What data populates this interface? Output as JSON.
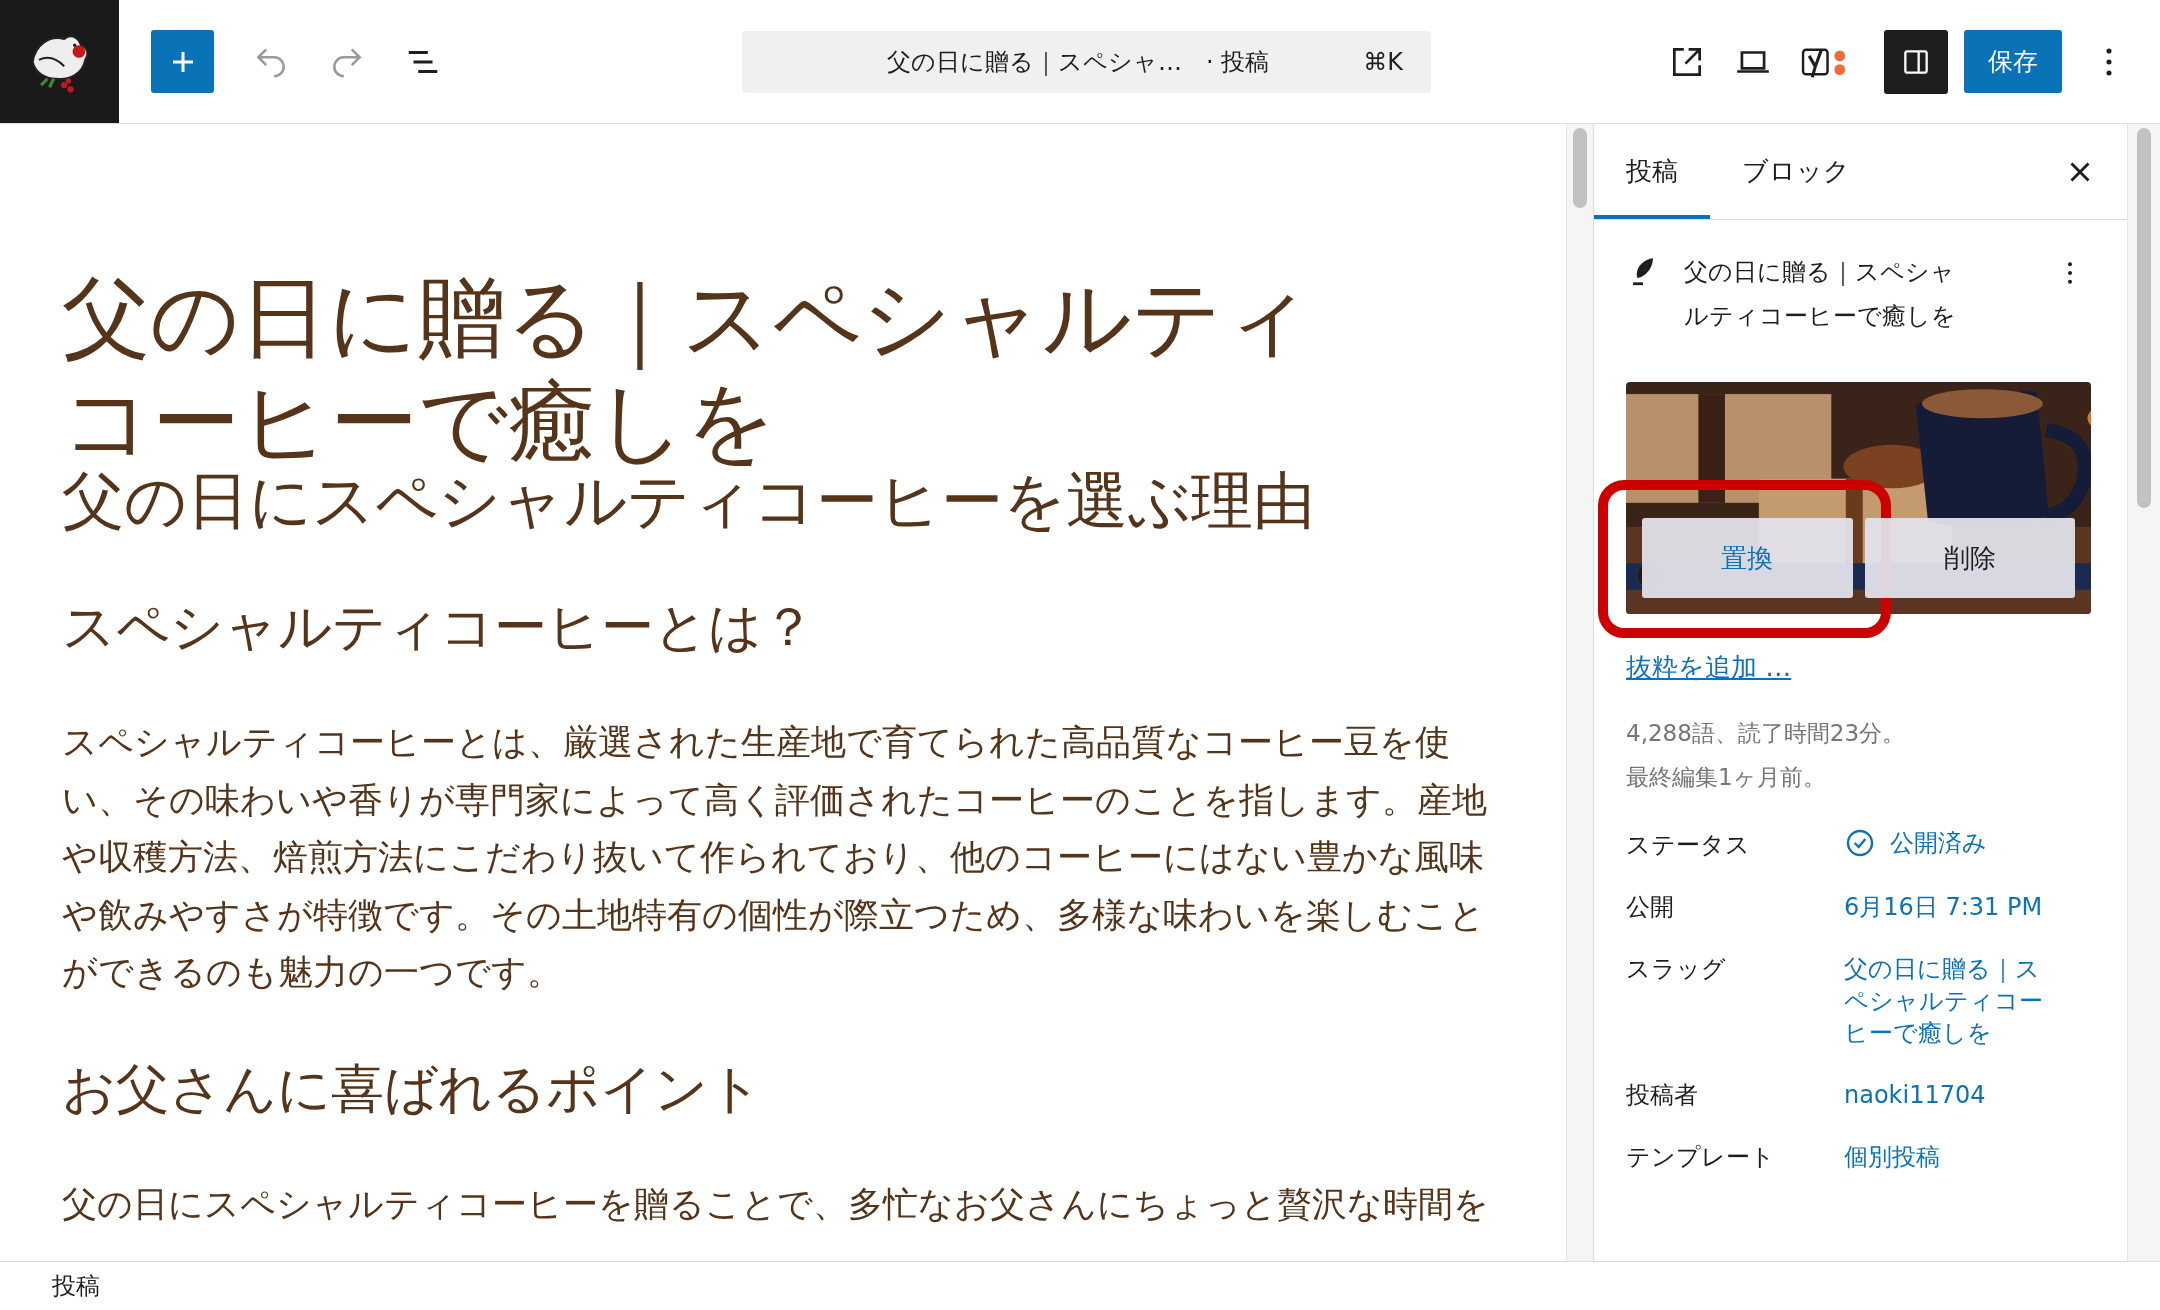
{
  "toolbar": {
    "document_title": "父の日に贈る｜スペシャ…",
    "document_type": "· 投稿",
    "shortcut": "⌘K",
    "save_button": "保存",
    "settings_panel_open": true
  },
  "editor": {
    "title": "父の日に贈る｜スペシャルティコーヒーで癒しを",
    "blocks": [
      {
        "kind": "heading2",
        "text": "父の日にスペシャルティコーヒーを選ぶ理由"
      },
      {
        "kind": "heading3",
        "text": "スペシャルティコーヒーとは？"
      },
      {
        "kind": "paragraph",
        "text": "スペシャルティコーヒーとは、厳選された生産地で育てられた高品質なコーヒー豆を使い、その味わいや香りが専門家によって高く評価されたコーヒーのことを指します。産地や収穫方法、焙煎方法にこだわり抜いて作られており、他のコーヒーにはない豊かな風味や飲みやすさが特徴です。その土地特有の個性が際立つため、多様な味わいを楽しむことができるのも魅力の一つです。"
      },
      {
        "kind": "heading3",
        "text": "お父さんに喜ばれるポイント"
      },
      {
        "kind": "paragraph",
        "text": "父の日にスペシャルティコーヒーを贈ることで、多忙なお父さんにちょっと贅沢な時間を"
      }
    ]
  },
  "sidebar": {
    "tabs": [
      {
        "label": "投稿",
        "selected": true
      },
      {
        "label": "ブロック",
        "selected": false
      }
    ],
    "post_title": "父の日に贈る｜スペシャルティコーヒーで癒しを",
    "featured_image": {
      "kind": "picture",
      "buttons": [
        {
          "label": "置換",
          "highlighted": true
        },
        {
          "label": "削除",
          "highlighted": false
        }
      ]
    },
    "excerpt_link": "抜粋を追加 …",
    "stats": [
      "4,288語、読了時間23分。",
      "最終編集1ヶ月前。"
    ],
    "fields": [
      {
        "kind": "status",
        "label": "ステータス",
        "value": "公開済み"
      },
      {
        "kind": "link",
        "label": "公開",
        "value": "6月16日 7:31 PM"
      },
      {
        "kind": "link",
        "label": "スラッグ",
        "value": "父の日に贈る｜スペシャルティコーヒーで癒しを"
      },
      {
        "kind": "link",
        "label": "投稿者",
        "value": "naoki11704"
      },
      {
        "kind": "link",
        "label": "テンプレート",
        "value": "個別投稿"
      }
    ]
  },
  "status_bar": {
    "breadcrumb": "投稿"
  }
}
